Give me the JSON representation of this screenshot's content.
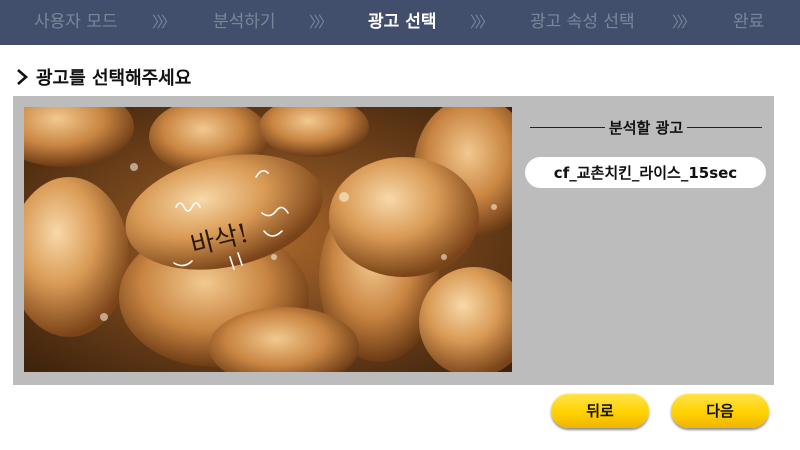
{
  "steps": [
    {
      "label": "사용자 모드",
      "active": false
    },
    {
      "label": "분석하기",
      "active": false
    },
    {
      "label": "광고 선택",
      "active": true
    },
    {
      "label": "광고 속성 선택",
      "active": false
    },
    {
      "label": "완료",
      "active": false
    }
  ],
  "separator": "〉〉〉",
  "heading": "광고를 선택해주세요",
  "preview": {
    "overlay_text": "바삭!"
  },
  "side_panel": {
    "title": "분석할 광고",
    "selected_ad": "cf_교촌치킨_라이스_15sec"
  },
  "buttons": {
    "back_label": "뒤로",
    "next_label": "다음"
  },
  "colors": {
    "stepbar_bg": "#424f6c",
    "step_inactive": "#7c869b",
    "step_active": "#ffffff",
    "panel_bg": "#bcbcbc",
    "button_yellow": "#ffd200"
  }
}
